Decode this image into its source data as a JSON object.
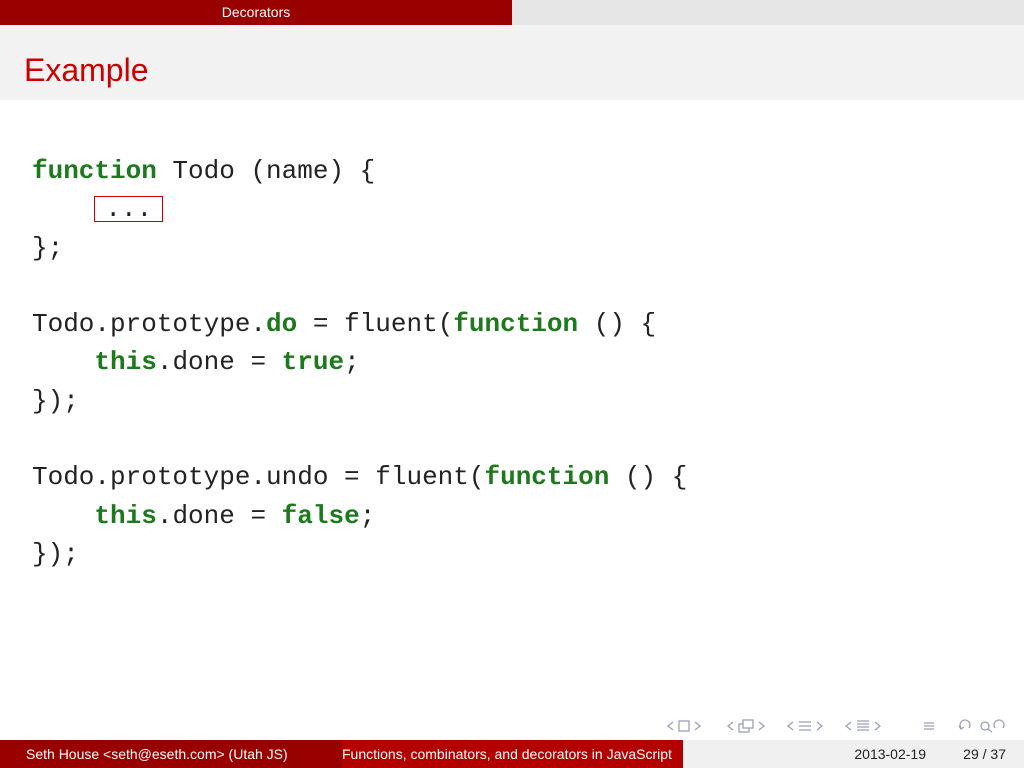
{
  "nav": {
    "section": "Decorators"
  },
  "frame": {
    "title": "Example"
  },
  "code": {
    "l1_kw": "function",
    "l1_rest": " Todo (name) {",
    "l2_indent": "    ",
    "l2_ellipsis": "...",
    "l3": "};",
    "l5_a": "Todo.prototype.",
    "l5_kw1": "do",
    "l5_b": " = fluent(",
    "l5_kw2": "function",
    "l5_c": " () {",
    "l6_indent": "    ",
    "l6_kw1": "this",
    "l6_b": ".done = ",
    "l6_kw2": "true",
    "l6_c": ";",
    "l7": "});",
    "l9_a": "Todo.prototype.undo = fluent(",
    "l9_kw": "function",
    "l9_b": " () {",
    "l10_indent": "    ",
    "l10_kw1": "this",
    "l10_b": ".done = ",
    "l10_kw2": "false",
    "l10_c": ";",
    "l11": "});"
  },
  "footer": {
    "author": "Seth House <seth@eseth.com>  (Utah JS)",
    "title": "Functions, combinators, and decorators in JavaScript",
    "date": "2013-02-19",
    "page": "29 / 37"
  },
  "colors": {
    "accent": "#990000",
    "title": "#cc0000",
    "keyword": "#1c7a1c"
  }
}
